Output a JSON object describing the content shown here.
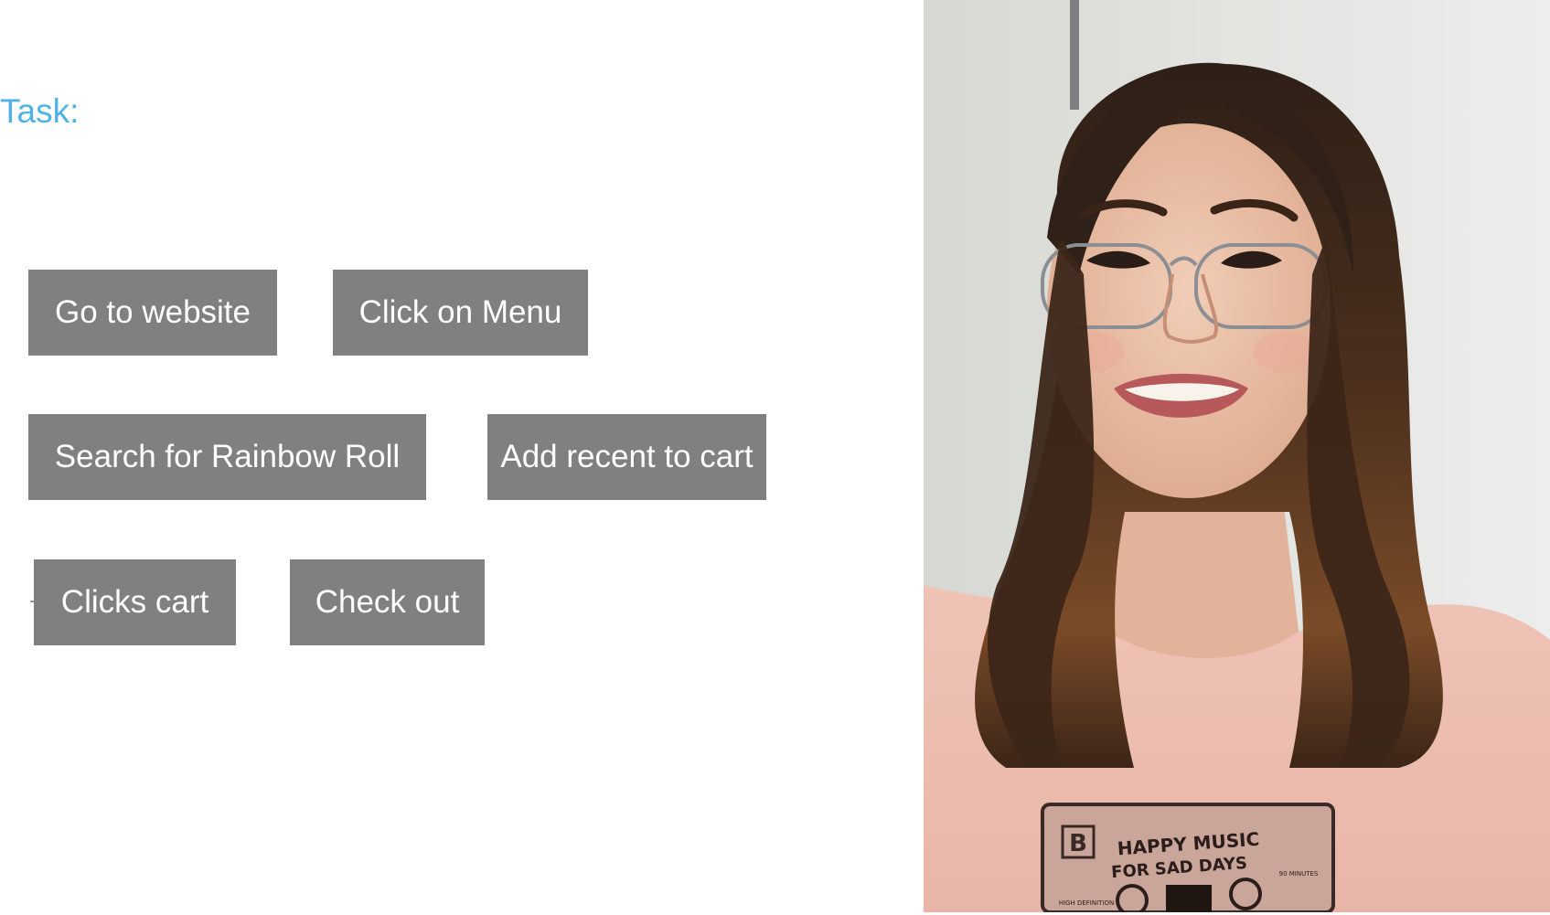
{
  "task": {
    "label": "Task:"
  },
  "steps": [
    {
      "label": "Go to website"
    },
    {
      "label": "Click on Menu"
    },
    {
      "label": "Search for Rainbow Roll"
    },
    {
      "label": "Add recent to cart"
    },
    {
      "label": "Clicks cart"
    },
    {
      "label": "Check out"
    }
  ],
  "photo": {
    "shirt_text_line1": "HAPPY MUSIC",
    "shirt_text_line2": "FOR SAD DAYS",
    "shirt_badge": "B",
    "shirt_small_left": "HIGH DEFINITION",
    "shirt_small_right": "90 MINUTES"
  },
  "colors": {
    "task_label": "#4fb3e8",
    "step_bg": "#808080",
    "step_text": "#ffffff"
  }
}
